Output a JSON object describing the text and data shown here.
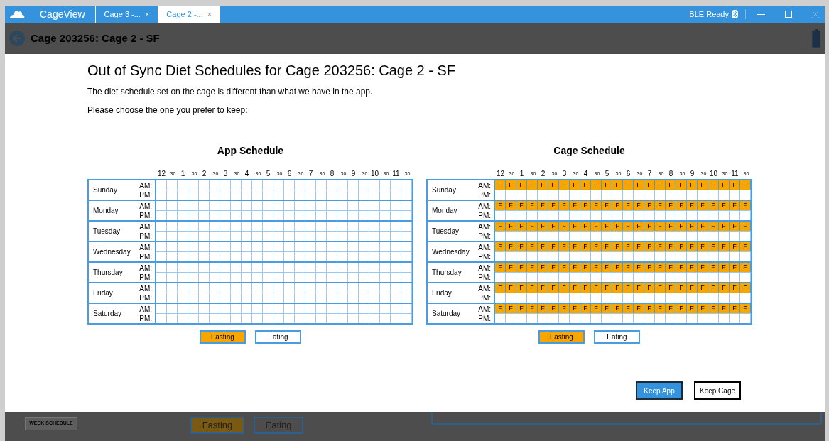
{
  "titlebar": {
    "app_name": "CageView",
    "tabs": [
      {
        "label": "Cage 3 -...",
        "close": "×",
        "selected": false
      },
      {
        "label": "Cage 2 -...",
        "close": "×",
        "selected": true
      }
    ],
    "status": "BLE Ready"
  },
  "header": {
    "title": "Cage 203256: Cage 2 - SF"
  },
  "dialog": {
    "title": "Out of Sync Diet Schedules for Cage 203256: Cage 2 - SF",
    "message": "The diet schedule set on the cage is different than what we have in the app.",
    "prompt": "Please choose the one you prefer to keep:",
    "schedules": [
      {
        "title": "App Schedule",
        "hours": [
          "12",
          ":30",
          "1",
          ":30",
          "2",
          ":30",
          "3",
          ":30",
          "4",
          ":30",
          "5",
          ":30",
          "6",
          ":30",
          "7",
          ":30",
          "8",
          ":30",
          "9",
          ":30",
          "10",
          ":30",
          "11",
          ":30"
        ],
        "days": [
          {
            "day": "Sunday",
            "am_label": "AM:",
            "pm_label": "PM:"
          },
          {
            "day": "Monday",
            "am_label": "AM:",
            "pm_label": "PM:"
          },
          {
            "day": "Tuesday",
            "am_label": "AM:",
            "pm_label": "PM:"
          },
          {
            "day": "Wednesday",
            "am_label": "AM:",
            "pm_label": "PM:"
          },
          {
            "day": "Thursday",
            "am_label": "AM:",
            "pm_label": "PM:"
          },
          {
            "day": "Friday",
            "am_label": "AM:",
            "pm_label": "PM:"
          },
          {
            "day": "Saturday",
            "am_label": "AM:",
            "pm_label": "PM:"
          }
        ],
        "legend": [
          {
            "label": "Fasting",
            "kind": "fasting"
          },
          {
            "label": "Eating",
            "kind": "eating"
          }
        ]
      },
      {
        "title": "Cage Schedule",
        "hours": [
          "12",
          ":30",
          "1",
          ":30",
          "2",
          ":30",
          "3",
          ":30",
          "4",
          ":30",
          "5",
          ":30",
          "6",
          ":30",
          "7",
          ":30",
          "8",
          ":30",
          "9",
          ":30",
          "10",
          ":30",
          "11",
          ":30"
        ],
        "days": [
          {
            "day": "Sunday",
            "am_label": "AM:",
            "pm_label": "PM:",
            "am": [
              "F",
              "F",
              "F",
              "F",
              "F",
              "F",
              "F",
              "F",
              "F",
              "F",
              "F",
              "F",
              "F",
              "F",
              "F",
              "F",
              "F",
              "F",
              "F",
              "F",
              "F",
              "F",
              "F",
              "F"
            ]
          },
          {
            "day": "Monday",
            "am_label": "AM:",
            "pm_label": "PM:",
            "am": [
              "F",
              "F",
              "F",
              "F",
              "F",
              "F",
              "F",
              "F",
              "F",
              "F",
              "F",
              "F",
              "F",
              "F",
              "F",
              "F",
              "F",
              "F",
              "F",
              "F",
              "F",
              "F",
              "F",
              "F"
            ]
          },
          {
            "day": "Tuesday",
            "am_label": "AM:",
            "pm_label": "PM:",
            "am": [
              "F",
              "F",
              "F",
              "F",
              "F",
              "F",
              "F",
              "F",
              "F",
              "F",
              "F",
              "F",
              "F",
              "F",
              "F",
              "F",
              "F",
              "F",
              "F",
              "F",
              "F",
              "F",
              "F",
              "F"
            ]
          },
          {
            "day": "Wednesday",
            "am_label": "AM:",
            "pm_label": "PM:",
            "am": [
              "F",
              "F",
              "F",
              "F",
              "F",
              "F",
              "F",
              "F",
              "F",
              "F",
              "F",
              "F",
              "F",
              "F",
              "F",
              "F",
              "F",
              "F",
              "F",
              "F",
              "F",
              "F",
              "F",
              "F"
            ]
          },
          {
            "day": "Thursday",
            "am_label": "AM:",
            "pm_label": "PM:",
            "am": [
              "F",
              "F",
              "F",
              "F",
              "F",
              "F",
              "F",
              "F",
              "F",
              "F",
              "F",
              "F",
              "F",
              "F",
              "F",
              "F",
              "F",
              "F",
              "F",
              "F",
              "F",
              "F",
              "F",
              "F"
            ]
          },
          {
            "day": "Friday",
            "am_label": "AM:",
            "pm_label": "PM:",
            "am": [
              "F",
              "F",
              "F",
              "F",
              "F",
              "F",
              "F",
              "F",
              "F",
              "F",
              "F",
              "F",
              "F",
              "F",
              "F",
              "F",
              "F",
              "F",
              "F",
              "F",
              "F",
              "F",
              "F",
              "F"
            ]
          },
          {
            "day": "Saturday",
            "am_label": "AM:",
            "pm_label": "PM:",
            "am": [
              "F",
              "F",
              "F",
              "F",
              "F",
              "F",
              "F",
              "F",
              "F",
              "F",
              "F",
              "F",
              "F",
              "F",
              "F",
              "F",
              "F",
              "F",
              "F",
              "F",
              "F",
              "F",
              "F",
              "F"
            ]
          }
        ],
        "legend": [
          {
            "label": "Fasting",
            "kind": "fasting"
          },
          {
            "label": "Eating",
            "kind": "eating"
          }
        ]
      }
    ],
    "buttons": [
      {
        "label": "Keep App",
        "primary": true
      },
      {
        "label": "Keep Cage",
        "primary": false
      }
    ]
  },
  "background": {
    "week_schedule": "WEEK SCHEDULE",
    "legend": [
      {
        "label": "Fasting",
        "kind": "fasting"
      },
      {
        "label": "Eating",
        "kind": "eating"
      }
    ]
  }
}
